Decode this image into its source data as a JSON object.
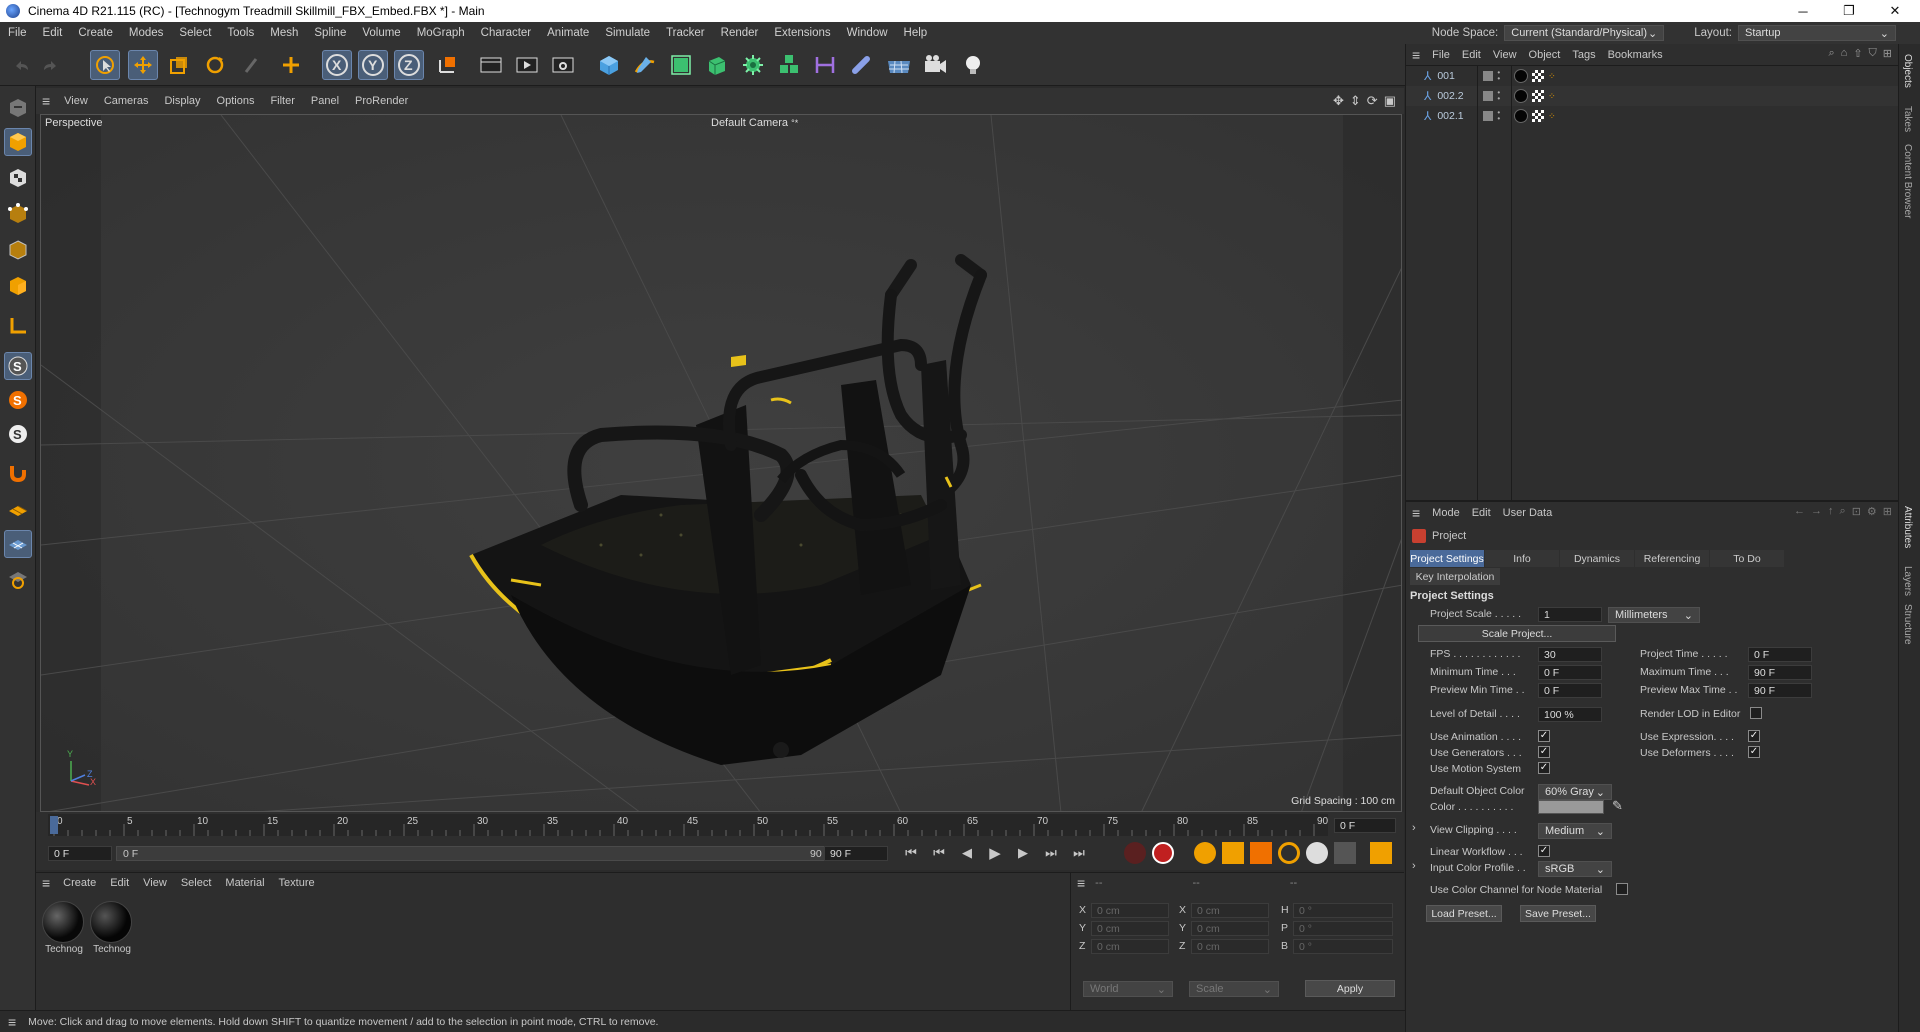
{
  "window": {
    "title": "Cinema 4D R21.115 (RC) - [Technogym Treadmill Skillmill_FBX_Embed.FBX *] - Main",
    "minimize": "─",
    "maximize": "❐",
    "close": "✕"
  },
  "menu": {
    "items": [
      "File",
      "Edit",
      "Create",
      "Modes",
      "Select",
      "Tools",
      "Mesh",
      "Spline",
      "Volume",
      "MoGraph",
      "Character",
      "Animate",
      "Simulate",
      "Tracker",
      "Render",
      "Extensions",
      "Window",
      "Help"
    ],
    "node_space_label": "Node Space:",
    "node_space_value": "Current (Standard/Physical)",
    "layout_label": "Layout:",
    "layout_value": "Startup"
  },
  "viewport": {
    "menu": [
      "View",
      "Cameras",
      "Display",
      "Options",
      "Filter",
      "Panel",
      "ProRender"
    ],
    "view_name": "Perspective",
    "camera": "Default Camera",
    "camera_glyph": "°*",
    "grid_spacing": "Grid Spacing : 100 cm",
    "axis_y": "Y",
    "axis_z": "Z",
    "axis_x": "X"
  },
  "timeline": {
    "ticks": [
      "0",
      "5",
      "10",
      "15",
      "20",
      "25",
      "30",
      "35",
      "40",
      "45",
      "50",
      "55",
      "60",
      "65",
      "70",
      "75",
      "80",
      "85",
      "90"
    ],
    "current_frame_right": "0 F",
    "start_field": "0 F",
    "range_start": "0 F",
    "range_end": "90 F",
    "end_field": "90 F"
  },
  "material_manager": {
    "menu": [
      "Create",
      "Edit",
      "View",
      "Select",
      "Material",
      "Texture"
    ],
    "materials": [
      {
        "name": "Technog"
      },
      {
        "name": "Technog"
      }
    ]
  },
  "coordinates": {
    "header": [
      "--",
      "--",
      "--"
    ],
    "rows": [
      {
        "a": "X",
        "av": "0 cm",
        "b": "X",
        "bv": "0 cm",
        "c": "H",
        "cv": "0 °"
      },
      {
        "a": "Y",
        "av": "0 cm",
        "b": "Y",
        "bv": "0 cm",
        "c": "P",
        "cv": "0 °"
      },
      {
        "a": "Z",
        "av": "0 cm",
        "b": "Z",
        "bv": "0 cm",
        "c": "B",
        "cv": "0 °"
      }
    ],
    "world": "World",
    "scale": "Scale",
    "apply": "Apply"
  },
  "status": {
    "text": "Move: Click and drag to move elements. Hold down SHIFT to quantize movement / add to the selection in point mode, CTRL to remove."
  },
  "object_manager": {
    "menu": [
      "File",
      "Edit",
      "View",
      "Object",
      "Tags",
      "Bookmarks"
    ],
    "objects": [
      {
        "name": "001"
      },
      {
        "name": "002.2"
      },
      {
        "name": "002.1"
      }
    ]
  },
  "side_tabs": {
    "top": [
      "Objects",
      "Takes",
      "Content Browser"
    ],
    "bottom": [
      "Attributes",
      "Layers",
      "Structure"
    ]
  },
  "attributes": {
    "menu": [
      "Mode",
      "Edit",
      "User Data"
    ],
    "object_name": "Project",
    "tabs": [
      "Project Settings",
      "Info",
      "Dynamics",
      "Referencing",
      "To Do"
    ],
    "tab2": "Key Interpolation",
    "section_title": "Project Settings",
    "project_scale_label": "Project Scale . . . . .",
    "project_scale_value": "1",
    "project_scale_unit": "Millimeters",
    "scale_project_btn": "Scale Project...",
    "fps_label": "FPS . . . . . . . . . . . .",
    "fps_value": "30",
    "project_time_label": "Project Time . . . . .",
    "project_time_value": "0 F",
    "min_time_label": "Minimum Time . . .",
    "min_time_value": "0 F",
    "max_time_label": "Maximum Time . . .",
    "max_time_value": "90 F",
    "prev_min_label": "Preview Min Time . .",
    "prev_min_value": "0 F",
    "prev_max_label": "Preview Max Time . .",
    "prev_max_value": "90 F",
    "lod_label": "Level of Detail . . . .",
    "lod_value": "100 %",
    "render_lod_label": "Render LOD in Editor",
    "use_animation_label": "Use Animation . . . .",
    "use_expression_label": "Use Expression. . . .",
    "use_generators_label": "Use Generators . . .",
    "use_deformers_label": "Use Deformers . . . .",
    "use_motion_label": "Use Motion System",
    "default_color_label": "Default Object Color",
    "default_color_value": "60% Gray",
    "color_label": "Color . . . . . . . . . .",
    "view_clipping_label": "View Clipping . . . .",
    "view_clipping_value": "Medium",
    "linear_workflow_label": "Linear Workflow . . .",
    "input_color_label": "Input Color Profile . .",
    "input_color_value": "sRGB",
    "use_color_channel_label": "Use Color Channel for Node Material",
    "load_preset": "Load Preset...",
    "save_preset": "Save Preset..."
  },
  "colors": {
    "accent": "#4a6a9a",
    "treadmill_yellow": "#e8c21a"
  }
}
